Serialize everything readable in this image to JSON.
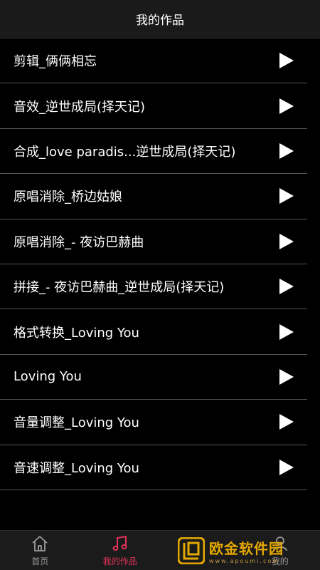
{
  "header": {
    "title": "我的作品"
  },
  "works": [
    {
      "title": "剪辑_俩俩相忘"
    },
    {
      "title": "音效_逆世成局(择天记)"
    },
    {
      "title": "合成_love paradis...逆世成局(择天记)"
    },
    {
      "title": "原唱消除_桥边姑娘"
    },
    {
      "title": "原唱消除_- 夜访巴赫曲"
    },
    {
      "title": "拼接_- 夜访巴赫曲_逆世成局(择天记)"
    },
    {
      "title": "格式转换_Loving You"
    },
    {
      "title": "Loving You"
    },
    {
      "title": "音量调整_Loving You"
    },
    {
      "title": "音速调整_Loving You"
    }
  ],
  "tabbar": {
    "tabs": [
      {
        "label": "首页",
        "icon": "home-icon"
      },
      {
        "label": "我的作品",
        "icon": "music-note-icon",
        "active": true
      },
      {
        "label": "",
        "icon": "hidden-icon"
      },
      {
        "label": "我的",
        "icon": "user-icon"
      }
    ]
  },
  "watermark": {
    "main": "欧金软件园",
    "sub": "www.apoumi.com"
  },
  "colors": {
    "accent": "#e3325a",
    "background": "#000000",
    "watermark": "#f0b000"
  }
}
